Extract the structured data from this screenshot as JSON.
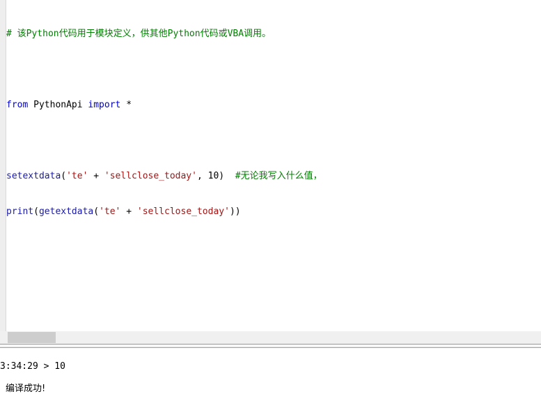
{
  "editor": {
    "lines": {
      "l1": {
        "comment": "# 该Python代码用于模块定义，供其他Python代码或VBA调用。"
      },
      "l2": {},
      "l3": {
        "from": "from",
        "module": " PythonApi ",
        "import": "import",
        "rest": " *"
      },
      "l4": {},
      "l5": {
        "func": "setextdata",
        "p1": "(",
        "s1": "'te'",
        "plus": " + ",
        "s2": "'sellclose_today'",
        "args": ", 10)  ",
        "comment": "#无论我写入什么值，"
      },
      "l6": {
        "func1": "print",
        "p1": "(",
        "func2": "getextdata",
        "p2": "(",
        "s1": "'te'",
        "plus": " + ",
        "s2": "'sellclose_today'",
        "p3": "))"
      }
    }
  },
  "output": {
    "line1": "3:34:29 > 10",
    "line2": "编译成功!"
  },
  "colors": {
    "comment": "#008000",
    "keyword": "#0000cc",
    "function": "#1a1aa6",
    "string": "#a31515"
  }
}
